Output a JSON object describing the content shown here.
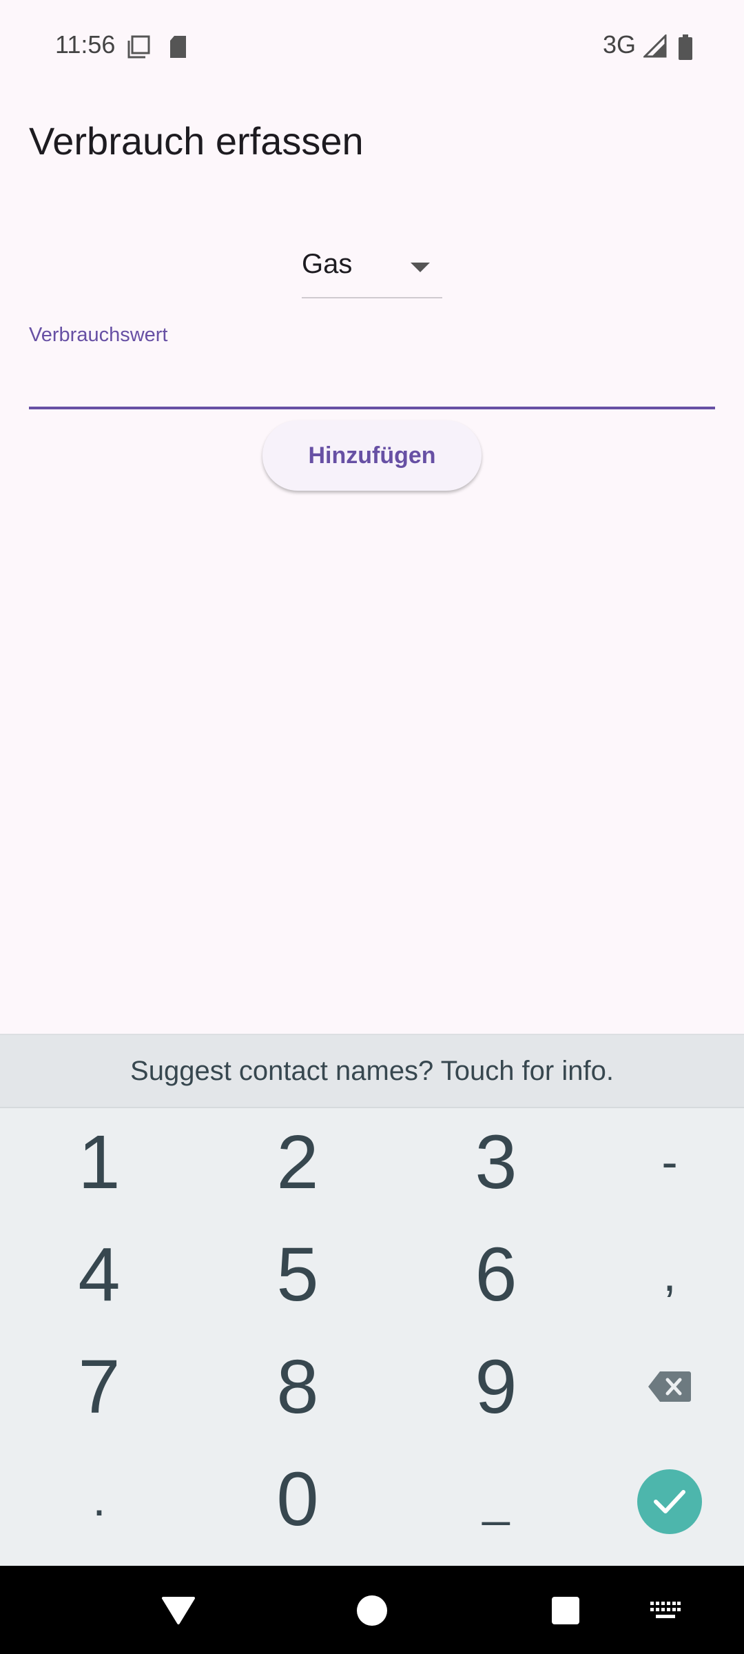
{
  "status_bar": {
    "time": "11:56",
    "network": "3G",
    "icons": [
      "screenshot-icon",
      "sd-card-icon",
      "signal-icon",
      "battery-icon"
    ]
  },
  "screen": {
    "title": "Verbrauch erfassen",
    "type_select": {
      "selected": "Gas"
    },
    "value_field": {
      "label": "Verbrauchswert",
      "value": ""
    },
    "add_button": "Hinzufügen"
  },
  "keyboard": {
    "suggestion": "Suggest contact names? Touch for info.",
    "keys": {
      "k1": "1",
      "k2": "2",
      "k3": "3",
      "minus": "-",
      "k4": "4",
      "k5": "5",
      "k6": "6",
      "comma": ",",
      "k7": "7",
      "k8": "8",
      "k9": "9",
      "period": ".",
      "k0": "0",
      "underscore": "_"
    },
    "enter_color": "#4db6ac"
  },
  "colors": {
    "accent": "#6750a4",
    "background": "#fdf7fb"
  }
}
